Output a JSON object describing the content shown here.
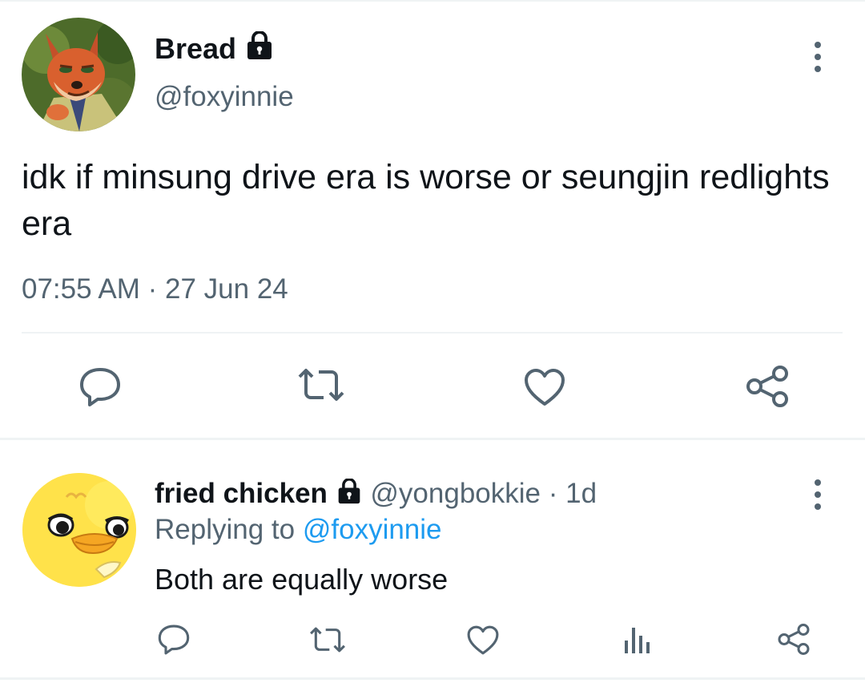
{
  "main_tweet": {
    "author": {
      "display_name": "Bread",
      "handle": "@foxyinnie",
      "avatar": "fox-avatar",
      "protected_icon": "lock-icon"
    },
    "text": "idk if minsung drive era is worse or seungjin redlights era",
    "time": "07:55 AM",
    "separator": "·",
    "date": "27 Jun 24",
    "actions": [
      {
        "name": "reply",
        "icon": "reply-icon"
      },
      {
        "name": "retweet",
        "icon": "retweet-icon"
      },
      {
        "name": "like",
        "icon": "heart-icon"
      },
      {
        "name": "share",
        "icon": "share-icon"
      }
    ]
  },
  "reply": {
    "author": {
      "display_name": "fried chicken",
      "handle": "@yongbokkie",
      "avatar": "duck-avatar",
      "protected_icon": "lock-icon"
    },
    "separator": "·",
    "time_ago": "1d",
    "replying_prefix": "Replying to",
    "replying_to": "@foxyinnie",
    "text": "Both are equally worse",
    "actions": [
      {
        "name": "reply",
        "icon": "reply-icon"
      },
      {
        "name": "retweet",
        "icon": "retweet-icon"
      },
      {
        "name": "like",
        "icon": "heart-icon"
      },
      {
        "name": "views",
        "icon": "views-icon"
      },
      {
        "name": "share",
        "icon": "share-icon"
      }
    ]
  },
  "colors": {
    "text_primary": "#0f1419",
    "text_secondary": "#536471",
    "mention": "#1d9bf0",
    "divider": "#eff3f4"
  }
}
